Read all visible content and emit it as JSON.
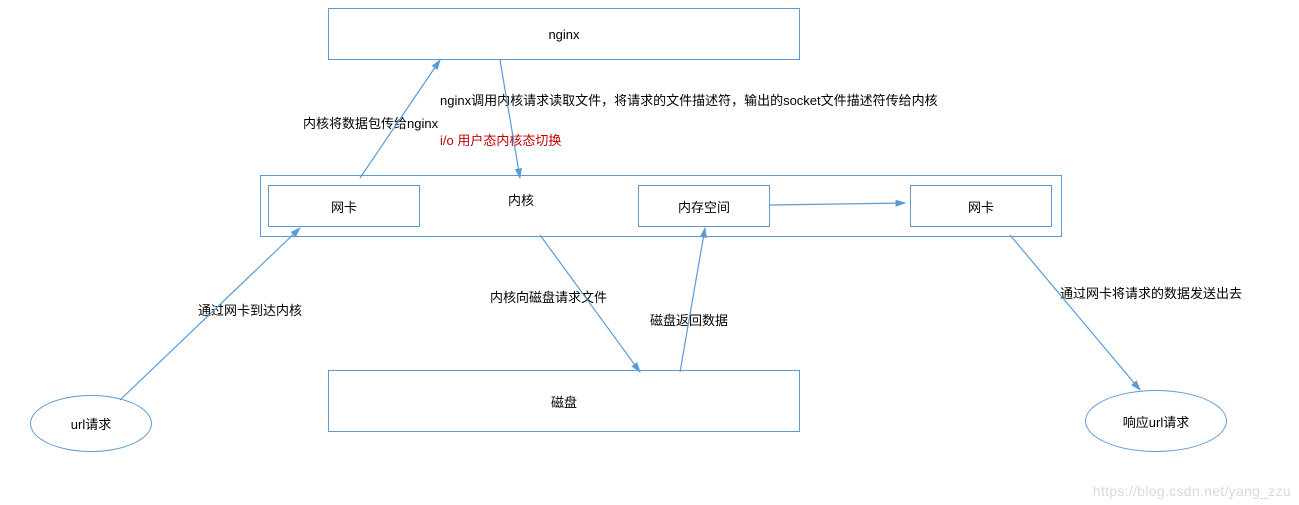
{
  "nodes": {
    "nginx": "nginx",
    "kernel_row": {
      "nic1": "网卡",
      "kernel": "内核",
      "memory": "内存空间",
      "nic2": "网卡"
    },
    "disk": "磁盘",
    "url_request": "url请求",
    "url_response": "响应url请求"
  },
  "labels": {
    "nginx_calls_kernel": "nginx调用内核请求读取文件，将请求的文件描述符，输出的socket文件描述符传给内核",
    "kernel_to_nginx": "内核将数据包传给nginx",
    "io_switch": "i/o 用户态内核态切换",
    "via_nic_to_kernel": "通过网卡到达内核",
    "kernel_to_disk": "内核向磁盘请求文件",
    "disk_returns": "磁盘返回数据",
    "via_nic_send": "通过网卡将请求的数据发送出去"
  },
  "watermark": "https://blog.csdn.net/yang_zzu"
}
